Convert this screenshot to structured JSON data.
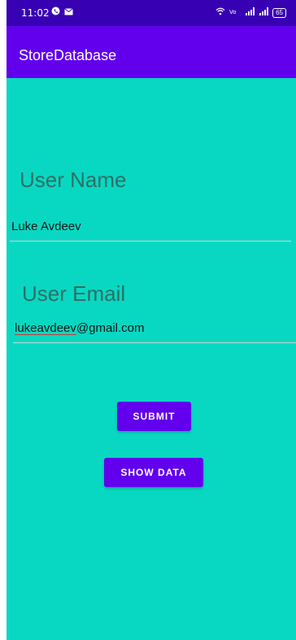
{
  "status_bar": {
    "time": "11:02",
    "left_icons": [
      "whatsapp-icon",
      "mail-icon"
    ],
    "right_icons": [
      "wifi-icon",
      "volte-icon",
      "signal-icon",
      "signal-icon"
    ],
    "battery": "65"
  },
  "app_bar": {
    "title": "StoreDatabase"
  },
  "form": {
    "name_label": "User Name",
    "name_value": "Luke Avdeev",
    "email_label": "User Email",
    "email_value_user": "lukeavdeev",
    "email_value_domain": "@gmail.com"
  },
  "buttons": {
    "submit": "SUBMIT",
    "show_data": "SHOW DATA"
  },
  "colors": {
    "background": "#08d8c2",
    "app_bar": "#6200ee",
    "status_bar": "#3700b3",
    "button": "#6200ee"
  }
}
